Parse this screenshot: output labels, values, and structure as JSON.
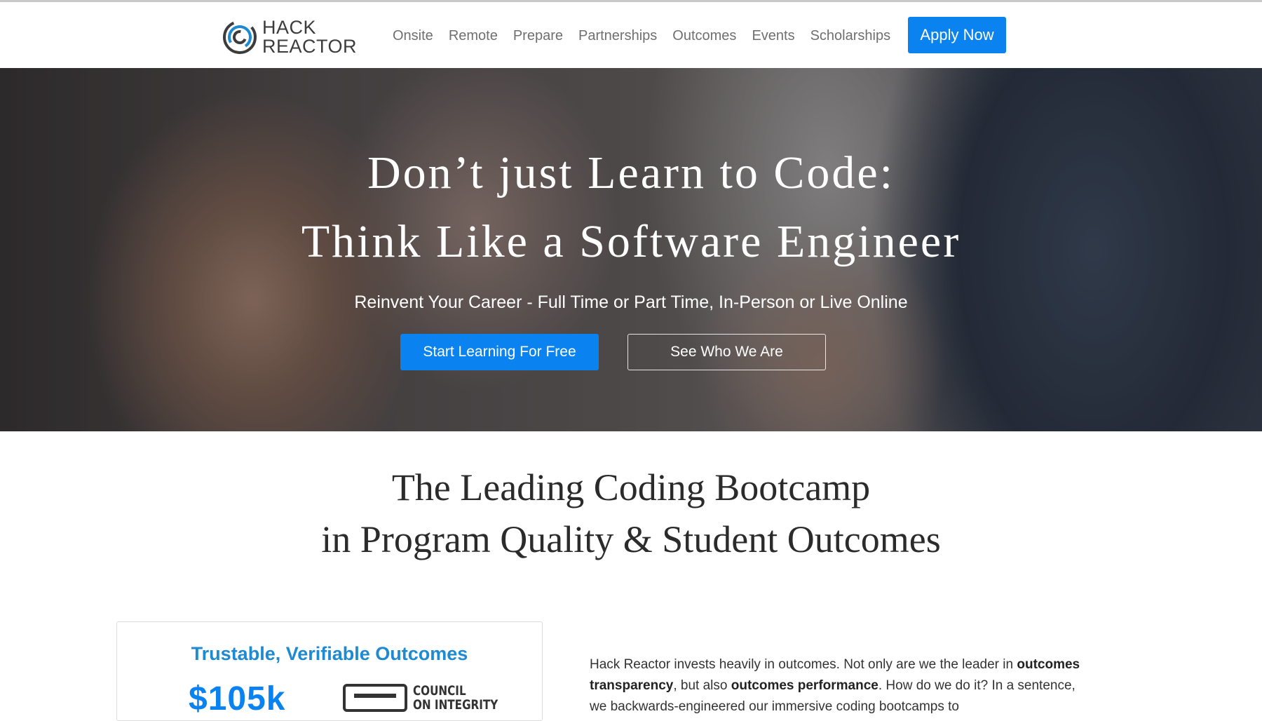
{
  "brand": {
    "logo_line1": "HACK",
    "logo_line2": "REACTOR",
    "accent_color": "#0a83f0",
    "heading_blue": "#1e8ad2"
  },
  "nav": {
    "links": [
      "Onsite",
      "Remote",
      "Prepare",
      "Partnerships",
      "Outcomes",
      "Events",
      "Scholarships"
    ],
    "apply_label": "Apply Now"
  },
  "hero": {
    "title_line1": "Don’t just Learn to Code:",
    "title_line2": "Think Like a Software Engineer",
    "subtitle": "Reinvent Your Career - Full Time or Part Time, In-Person or Live Online",
    "primary_cta": "Start Learning For Free",
    "secondary_cta": "See Who We Are"
  },
  "leading": {
    "line1": "The Leading Coding Bootcamp",
    "line2": "in Program Quality & Student Outcomes"
  },
  "card": {
    "title": "Trustable, Verifiable Outcomes",
    "stat": "$105k",
    "council_line1": "COUNCIL",
    "council_line2": "ON INTEGRITY"
  },
  "paragraph": {
    "p1": "Hack Reactor invests heavily in outcomes. Not only are we the leader in",
    "b1": "outcomes transparency",
    "p2": ", but also ",
    "b2": "outcomes performance",
    "p3": ". How do we do it? In a sentence, we backwards-engineered our immersive coding bootcamps to"
  },
  "icons": {
    "logo": "hack-reactor-logo-icon"
  }
}
